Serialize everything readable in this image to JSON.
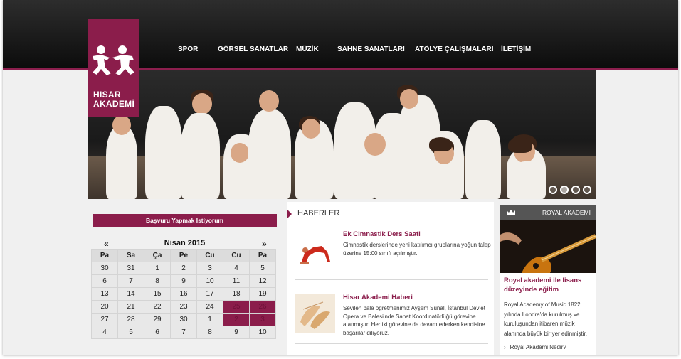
{
  "brand": {
    "line1": "HISAR",
    "line2": "AKADEMİ",
    "color": "#8b1d4b"
  },
  "nav": [
    {
      "label": "SPOR"
    },
    {
      "label": "GÖRSEL SANATLAR"
    },
    {
      "label": "MÜZİK"
    },
    {
      "label": "SAHNE SANATLARI"
    },
    {
      "label": "ATÖLYE ÇALIŞMALARI"
    },
    {
      "label": "İLETİŞİM"
    }
  ],
  "hero": {
    "slides": 4,
    "active_slide": 2
  },
  "apply_button": "Başvuru Yapmak İstiyorum",
  "calendar": {
    "prev": "«",
    "next": "»",
    "title": "Nisan 2015",
    "weekdays": [
      "Pa",
      "Sa",
      "Ça",
      "Pe",
      "Cu",
      "Cu",
      "Pa"
    ],
    "weeks": [
      [
        "30",
        "31",
        "1",
        "2",
        "3",
        "4",
        "5"
      ],
      [
        "6",
        "7",
        "8",
        "9",
        "10",
        "11",
        "12"
      ],
      [
        "13",
        "14",
        "15",
        "16",
        "17",
        "18",
        "19"
      ],
      [
        "20",
        "21",
        "22",
        "23",
        "24",
        "25",
        "26"
      ],
      [
        "27",
        "28",
        "29",
        "30",
        "1",
        "2",
        "3"
      ],
      [
        "4",
        "5",
        "6",
        "7",
        "8",
        "9",
        "10"
      ]
    ],
    "highlighted": [
      "25",
      "26",
      "2",
      "3"
    ]
  },
  "news": {
    "header": "HABERLER",
    "items": [
      {
        "title": "Ek Cimnastik Ders Saati",
        "text": "Cimnastik derslerinde yeni katılımcı gruplarına yoğun talep üzerine 15:00 sınıfı açılmıştır.",
        "thumb_icon": "gymnast-icon"
      },
      {
        "title": "Hisar Akademi Haberi",
        "text": "Sevilen bale öğretmenimiz Ayşem Sunal, İstanbul Devlet Opera ve Balesi'nde Sanat Koordinatörlüğü görevine atanmıştır. Her iki görevine de devam ederken kendisine başarılar diliyoruz.",
        "thumb_icon": "ballet-shoes-icon"
      }
    ]
  },
  "royal": {
    "header": "ROYAL AKADEMİ",
    "title": "Royal akademi ile lisans düzeyinde eğitim",
    "text": "Royal Academy of Music 1822 yılında Londra'da kurulmuş ve kuruluşundan itibaren müzik alanında büyük bir yer edinmiştir.",
    "link": "Royal Akademi Nedir?",
    "link_bullet": "›"
  }
}
